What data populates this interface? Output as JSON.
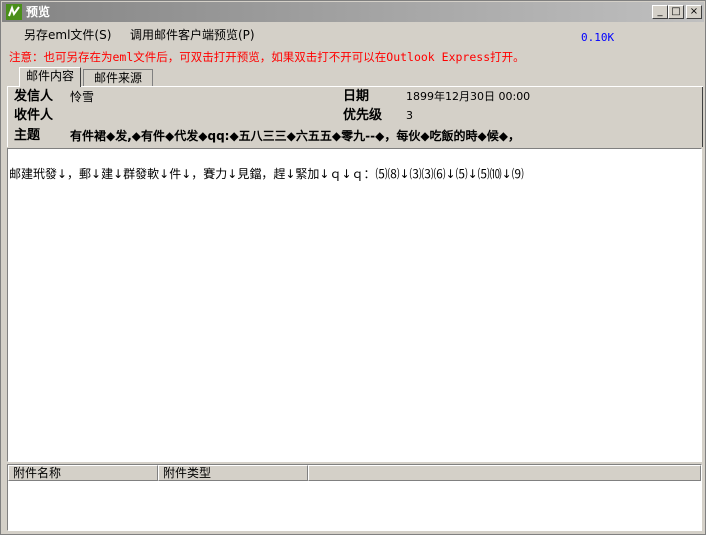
{
  "window": {
    "title": "预览"
  },
  "titlebar_buttons": {
    "minimize": "_",
    "maximize": "□",
    "close": "×"
  },
  "menu": {
    "save_eml": "另存eml文件(S)",
    "open_client": "调用邮件客户端预览(P)"
  },
  "size_label": "0.10K",
  "notice": "注意：也可另存在为eml文件后，可双击打开预览，如果双击打不开可以在Outlook Express打开。",
  "tabs": [
    {
      "label": "邮件内容",
      "active": true
    },
    {
      "label": "邮件来源",
      "active": false
    }
  ],
  "header": {
    "from_label": "发信人",
    "from_value": "怜雪",
    "to_label": "收件人",
    "to_value": "",
    "subject_label": "主题",
    "subject_value": "有件裙◆发,◆有件◆代发◆qq:◆五八三三◆六五五◆零九--◆，每伙◆吃飯的時◆候◆，",
    "date_label": "日期",
    "date_value": "1899年12月30日 00:00",
    "priority_label": "优先级",
    "priority_value": "3"
  },
  "body": {
    "text": "邮建玳發↓，郵↓建↓群發軟↓件↓，賽力↓見鐺，趕↓緊加↓ｑ↓ｑ：⑸⑻↓⑶⑶⑹↓⑸↓⑸⑽↓⑼"
  },
  "attachments": {
    "columns": [
      "附件名称",
      "附件类型"
    ]
  },
  "colors": {
    "titlebar": "#848484",
    "notice": "#ff0000",
    "size_label": "#0000ff",
    "window_bg": "#d4d0c8"
  }
}
